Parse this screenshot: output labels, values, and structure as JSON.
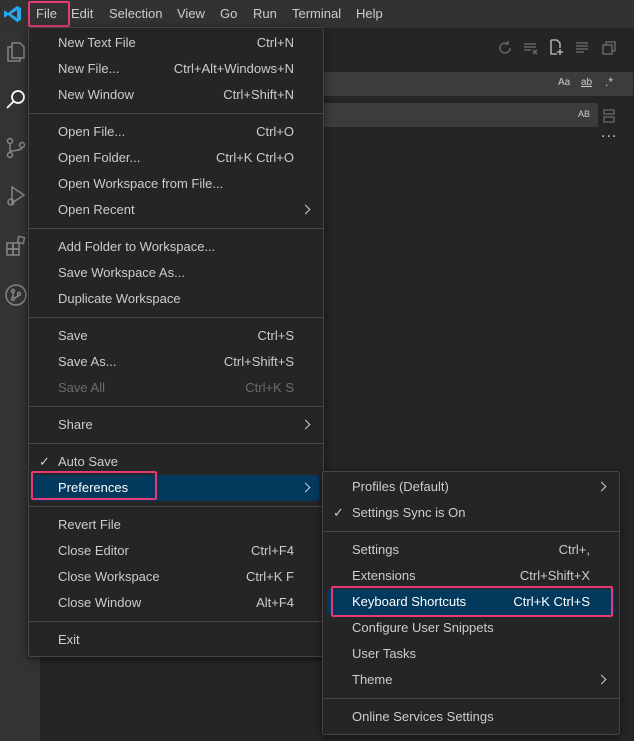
{
  "menubar": {
    "items": [
      "File",
      "Edit",
      "Selection",
      "View",
      "Go",
      "Run",
      "Terminal",
      "Help"
    ]
  },
  "activity_bar": {
    "icons": [
      "explorer-icon",
      "search-icon",
      "source-control-icon",
      "run-debug-icon",
      "extensions-icon",
      "git-graph-icon"
    ]
  },
  "search_panel": {
    "toolbar_icons": [
      "refresh-icon",
      "clear-results-icon",
      "new-search-editor-icon",
      "collapse-all-icon",
      "view-as-tree-icon"
    ],
    "search_options": [
      "Aa",
      "ab",
      ".*"
    ],
    "replace_options": [
      "AB"
    ],
    "more_label": "..."
  },
  "file_menu": {
    "sections": [
      [
        {
          "label": "New Text File",
          "key": "Ctrl+N"
        },
        {
          "label": "New File...",
          "key": "Ctrl+Alt+Windows+N"
        },
        {
          "label": "New Window",
          "key": "Ctrl+Shift+N"
        }
      ],
      [
        {
          "label": "Open File...",
          "key": "Ctrl+O"
        },
        {
          "label": "Open Folder...",
          "key": "Ctrl+K Ctrl+O"
        },
        {
          "label": "Open Workspace from File...",
          "key": ""
        },
        {
          "label": "Open Recent",
          "key": "",
          "submenu": true
        }
      ],
      [
        {
          "label": "Add Folder to Workspace...",
          "key": ""
        },
        {
          "label": "Save Workspace As...",
          "key": ""
        },
        {
          "label": "Duplicate Workspace",
          "key": ""
        }
      ],
      [
        {
          "label": "Save",
          "key": "Ctrl+S"
        },
        {
          "label": "Save As...",
          "key": "Ctrl+Shift+S"
        },
        {
          "label": "Save All",
          "key": "Ctrl+K S",
          "disabled": true
        }
      ],
      [
        {
          "label": "Share",
          "key": "",
          "submenu": true
        }
      ],
      [
        {
          "label": "Auto Save",
          "key": "",
          "checked": true
        },
        {
          "label": "Preferences",
          "key": "",
          "submenu": true,
          "active": true
        }
      ],
      [
        {
          "label": "Revert File",
          "key": ""
        },
        {
          "label": "Close Editor",
          "key": "Ctrl+F4"
        },
        {
          "label": "Close Workspace",
          "key": "Ctrl+K F"
        },
        {
          "label": "Close Window",
          "key": "Alt+F4"
        }
      ],
      [
        {
          "label": "Exit",
          "key": ""
        }
      ]
    ]
  },
  "preferences_menu": {
    "sections": [
      [
        {
          "label": "Profiles (Default)",
          "key": "",
          "submenu": true
        },
        {
          "label": "Settings Sync is On",
          "key": "",
          "checked": true
        }
      ],
      [
        {
          "label": "Settings",
          "key": "Ctrl+,"
        },
        {
          "label": "Extensions",
          "key": "Ctrl+Shift+X"
        },
        {
          "label": "Keyboard Shortcuts",
          "key": "Ctrl+K Ctrl+S",
          "active": true
        },
        {
          "label": "Configure User Snippets",
          "key": ""
        },
        {
          "label": "User Tasks",
          "key": ""
        },
        {
          "label": "Theme",
          "key": "",
          "submenu": true
        }
      ],
      [
        {
          "label": "Online Services Settings",
          "key": ""
        }
      ]
    ]
  },
  "colors": {
    "highlight_border": "#e63a77",
    "active_item_bg": "#04395e",
    "vscode_blue": "#23a9f2"
  }
}
